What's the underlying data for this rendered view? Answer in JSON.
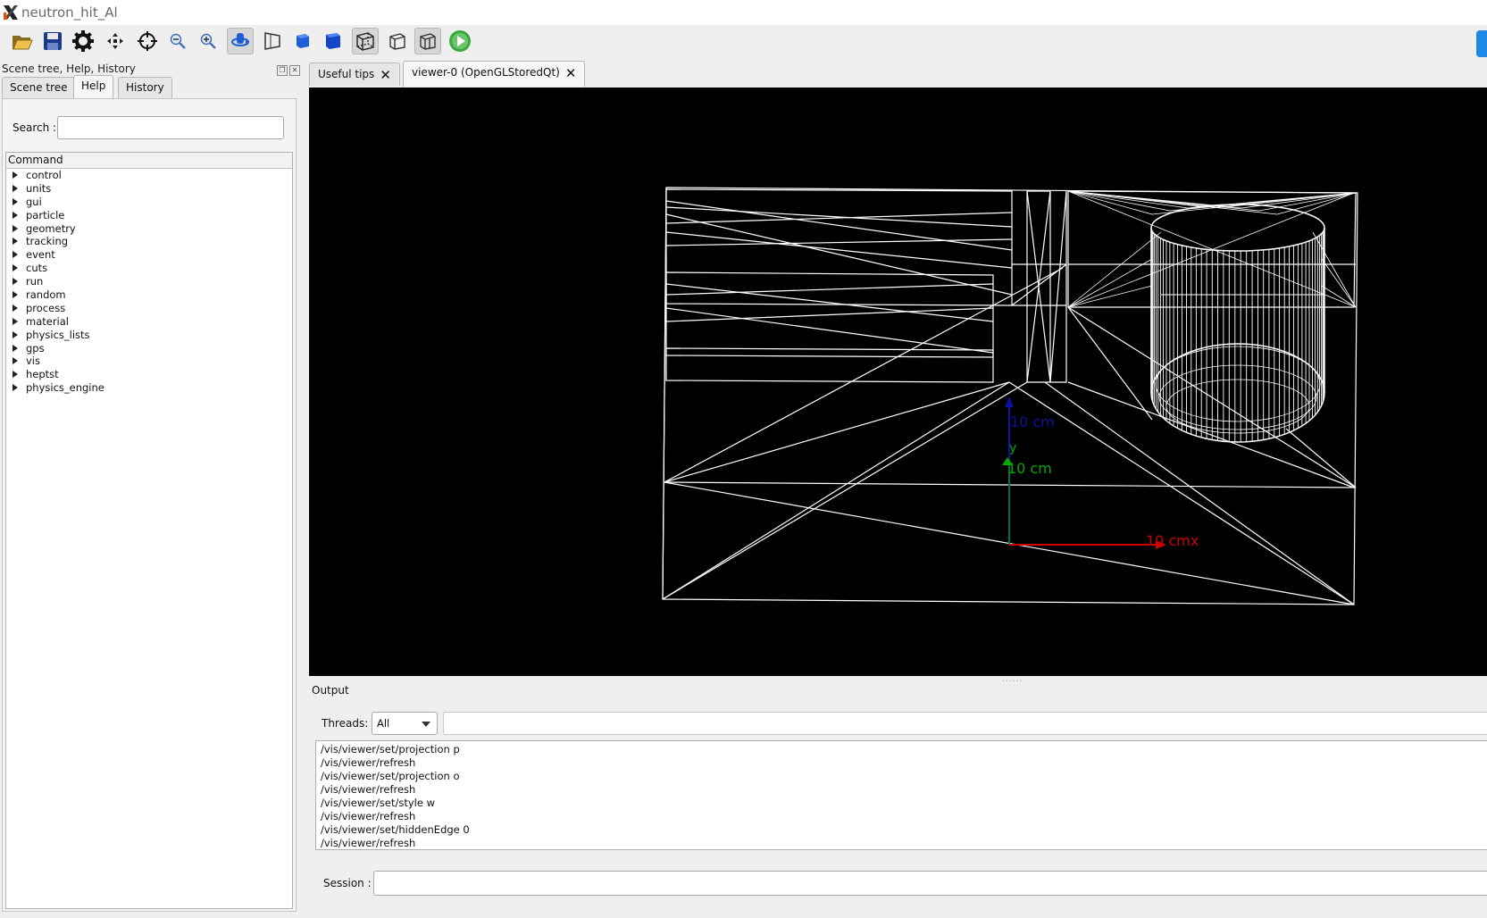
{
  "window": {
    "title": "neutron_hit_Al",
    "accent": "#1e88e5"
  },
  "toolbar": {
    "buttons": [
      "open-folder-icon",
      "save-icon",
      "gear-icon",
      "move-icon",
      "crosshair-icon",
      "zoom-out-icon",
      "zoom-in-icon",
      "rotate-icon",
      "perspective-icon",
      "solid-icon",
      "solid-blue-icon",
      "wireframe-box-icon",
      "hidden-line-icon",
      "hidden-surface-icon",
      "run-icon"
    ]
  },
  "dock": {
    "title": "Scene tree, Help, History",
    "tabs": [
      "Scene tree",
      "Help",
      "History"
    ],
    "active_tab": "Help",
    "search_label": "Search :",
    "search_value": "",
    "tree_header": "Command",
    "tree_items": [
      "control",
      "units",
      "gui",
      "particle",
      "geometry",
      "tracking",
      "event",
      "cuts",
      "run",
      "random",
      "process",
      "material",
      "physics_lists",
      "gps",
      "vis",
      "heptst",
      "physics_engine"
    ]
  },
  "viewer_tabs": [
    {
      "label": "Useful tips",
      "active": false
    },
    {
      "label": "viewer-0 (OpenGLStoredQt)",
      "active": true
    }
  ],
  "scene": {
    "axis_labels": {
      "z": "10 cm",
      "y_letter": "y",
      "y": "10 cm",
      "x": "10 cmx"
    },
    "colors": {
      "background": "#000000",
      "wire": "#ffffff",
      "x": "#cc0000",
      "y": "#00aa00",
      "z": "#1010a0"
    }
  },
  "output": {
    "label": "Output",
    "threads_label": "Threads:",
    "threads_value": "All",
    "lines": [
      "/vis/viewer/set/projection p",
      "/vis/viewer/refresh",
      "/vis/viewer/set/projection o",
      "/vis/viewer/refresh",
      "/vis/viewer/set/style w",
      "/vis/viewer/refresh",
      "/vis/viewer/set/hiddenEdge 0",
      "/vis/viewer/refresh"
    ]
  },
  "session": {
    "label": "Session :",
    "value": ""
  }
}
